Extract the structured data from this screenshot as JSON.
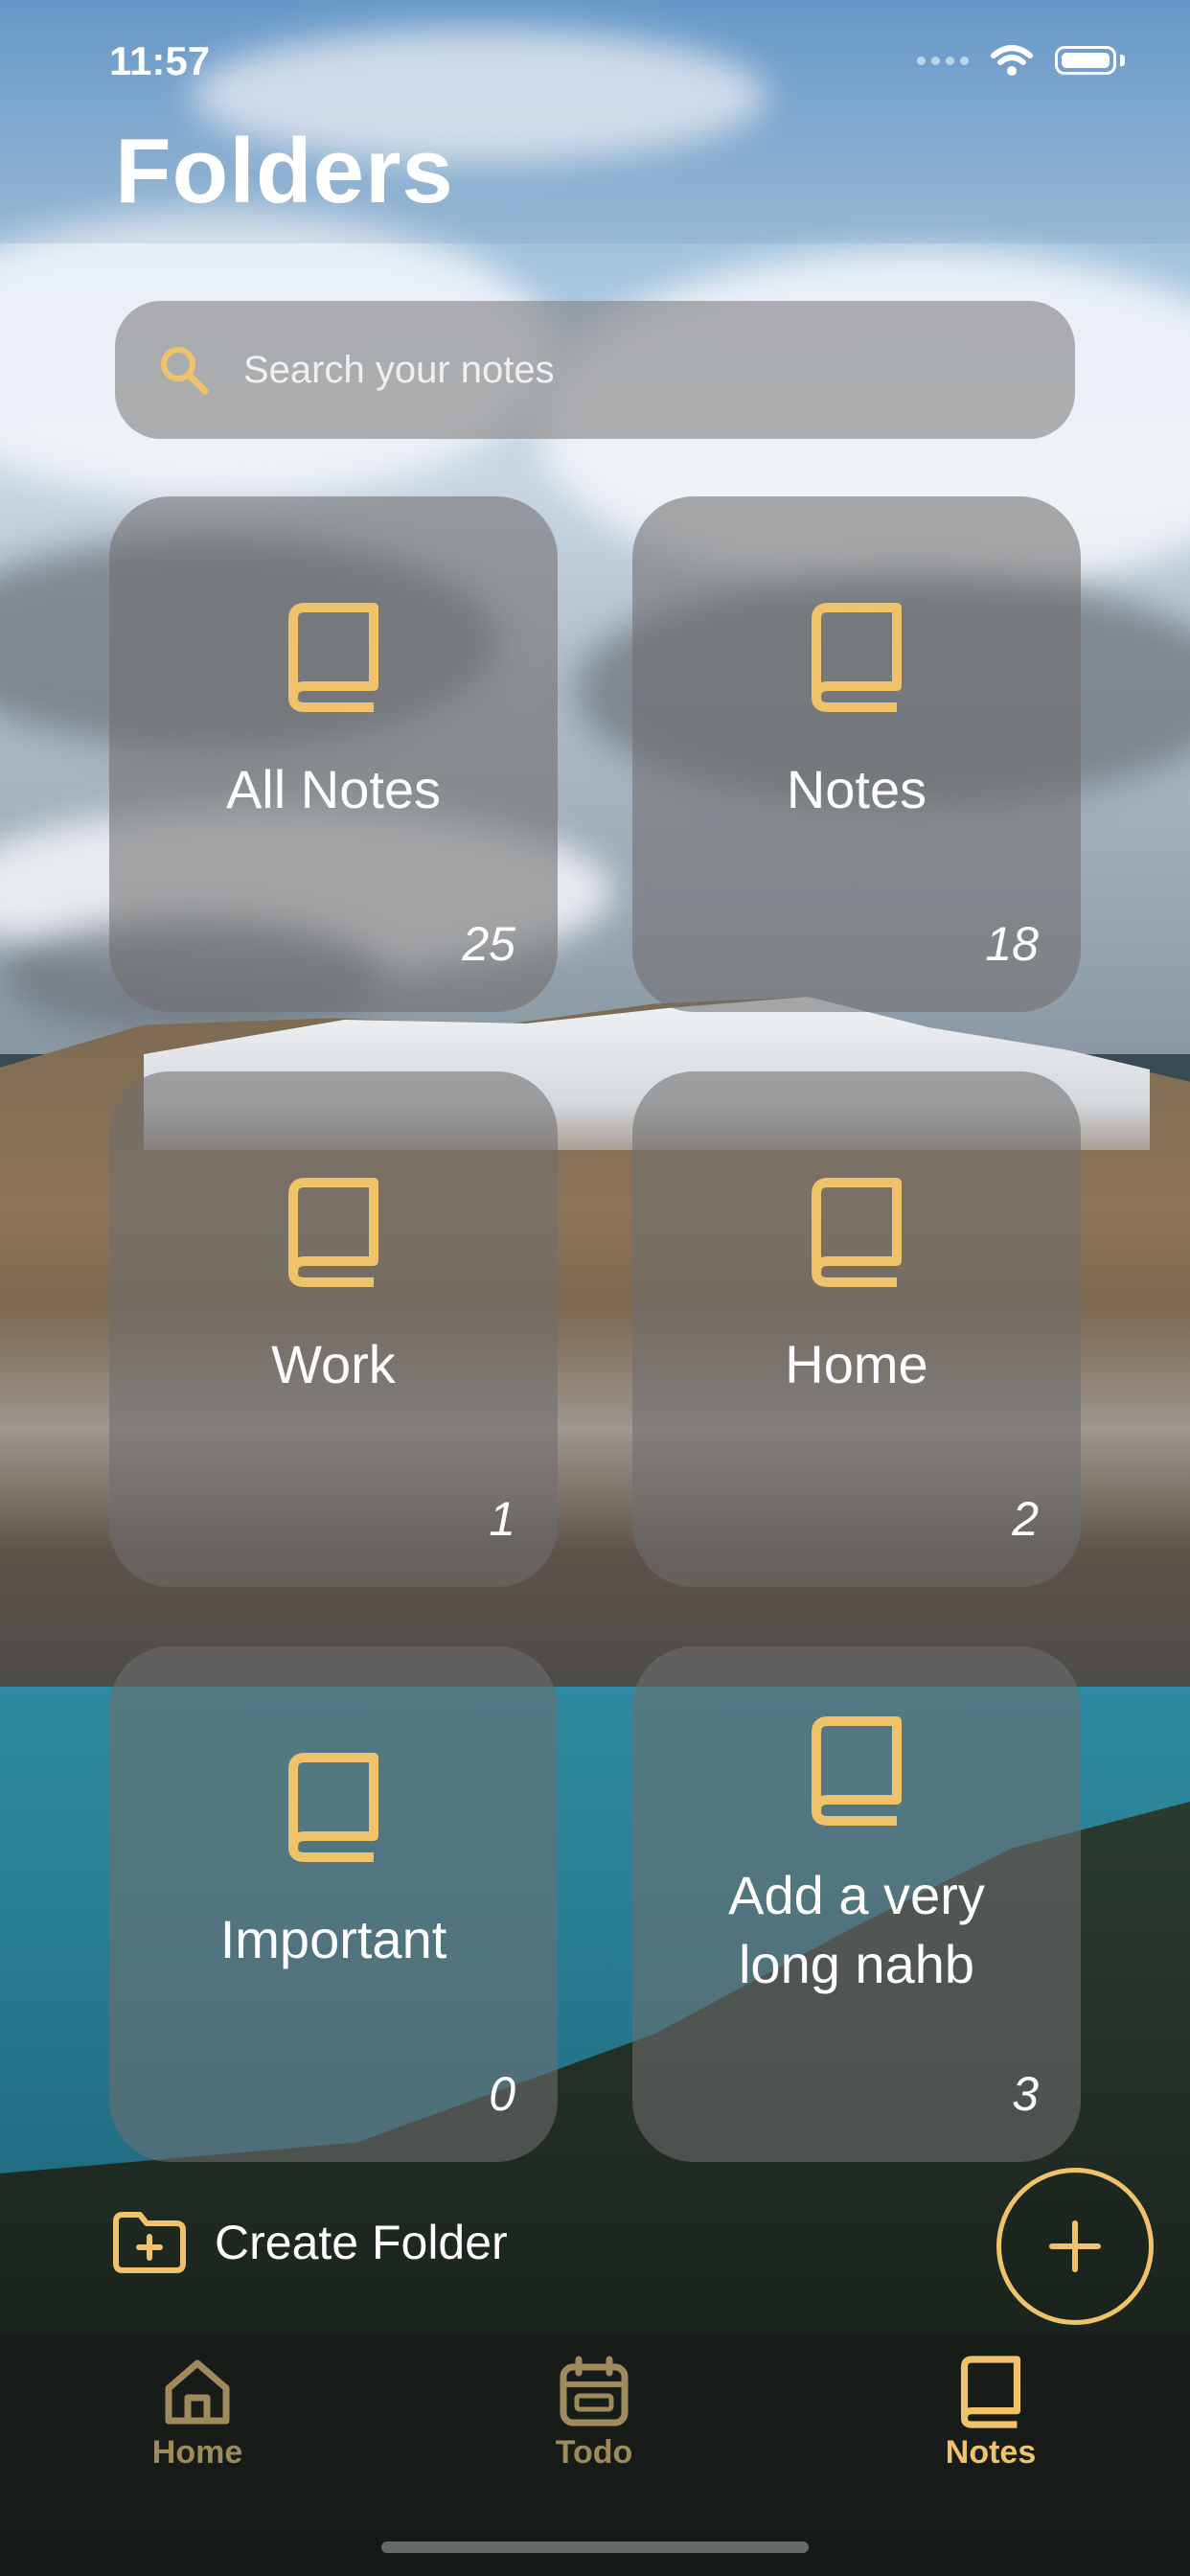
{
  "status_bar": {
    "time": "11:57"
  },
  "header": {
    "title": "Folders"
  },
  "search": {
    "placeholder": "Search your notes"
  },
  "folders": [
    {
      "name": "All Notes",
      "count": "25"
    },
    {
      "name": "Notes",
      "count": "18"
    },
    {
      "name": "Work",
      "count": "1"
    },
    {
      "name": "Home",
      "count": "2"
    },
    {
      "name": "Important",
      "count": "0"
    },
    {
      "name": "Add a very long nahb",
      "count": "3"
    }
  ],
  "actions": {
    "create_folder_label": "Create Folder"
  },
  "tab_bar": {
    "items": [
      {
        "label": "Home",
        "icon": "house-icon"
      },
      {
        "label": "Todo",
        "icon": "calendar-icon"
      },
      {
        "label": "Notes",
        "icon": "book-icon",
        "active": true
      }
    ]
  },
  "colors": {
    "accent": "#f0c26a",
    "accent_dim": "#9f8a5c"
  }
}
